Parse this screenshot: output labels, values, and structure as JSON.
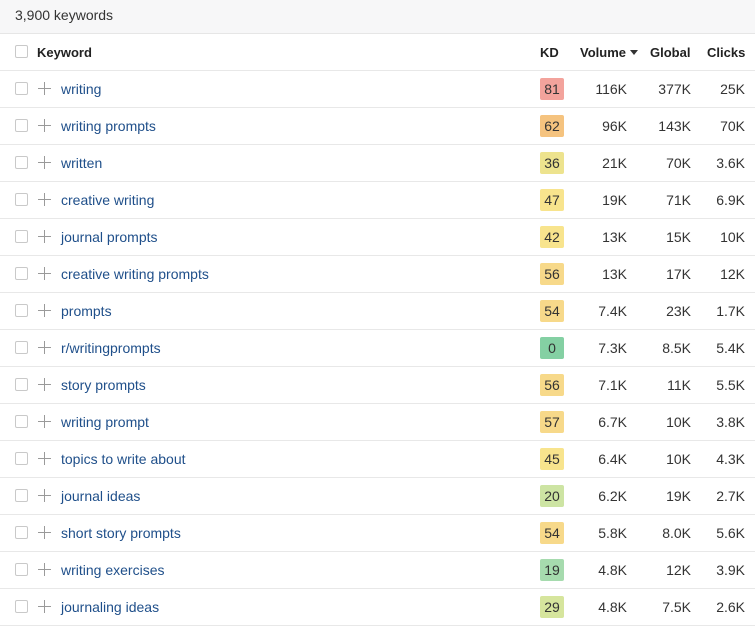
{
  "summary": {
    "count_label": "3,900 keywords"
  },
  "header": {
    "keyword": "Keyword",
    "kd": "KD",
    "volume": "Volume",
    "global": "Global",
    "clicks": "Clicks"
  },
  "kd_colors": {
    "red": "#f3a39c",
    "orange": "#f5c37f",
    "yellow": "#f8e48d",
    "light_green": "#d6e59d",
    "green": "#84d0a3"
  },
  "rows": [
    {
      "keyword": "writing",
      "kd": "81",
      "kd_color": "#f3a39c",
      "volume": "116K",
      "global": "377K",
      "clicks": "25K"
    },
    {
      "keyword": "writing prompts",
      "kd": "62",
      "kd_color": "#f5c37f",
      "volume": "96K",
      "global": "143K",
      "clicks": "70K"
    },
    {
      "keyword": "written",
      "kd": "36",
      "kd_color": "#ede38e",
      "volume": "21K",
      "global": "70K",
      "clicks": "3.6K"
    },
    {
      "keyword": "creative writing",
      "kd": "47",
      "kd_color": "#f8e48d",
      "volume": "19K",
      "global": "71K",
      "clicks": "6.9K"
    },
    {
      "keyword": "journal prompts",
      "kd": "42",
      "kd_color": "#f8e48d",
      "volume": "13K",
      "global": "15K",
      "clicks": "10K"
    },
    {
      "keyword": "creative writing prompts",
      "kd": "56",
      "kd_color": "#f7d98a",
      "volume": "13K",
      "global": "17K",
      "clicks": "12K"
    },
    {
      "keyword": "prompts",
      "kd": "54",
      "kd_color": "#f7d98a",
      "volume": "7.4K",
      "global": "23K",
      "clicks": "1.7K"
    },
    {
      "keyword": "r/writingprompts",
      "kd": "0",
      "kd_color": "#84d0a3",
      "volume": "7.3K",
      "global": "8.5K",
      "clicks": "5.4K"
    },
    {
      "keyword": "story prompts",
      "kd": "56",
      "kd_color": "#f7d98a",
      "volume": "7.1K",
      "global": "11K",
      "clicks": "5.5K"
    },
    {
      "keyword": "writing prompt",
      "kd": "57",
      "kd_color": "#f7d98a",
      "volume": "6.7K",
      "global": "10K",
      "clicks": "3.8K"
    },
    {
      "keyword": "topics to write about",
      "kd": "45",
      "kd_color": "#f8e48d",
      "volume": "6.4K",
      "global": "10K",
      "clicks": "4.3K"
    },
    {
      "keyword": "journal ideas",
      "kd": "20",
      "kd_color": "#cde4a3",
      "volume": "6.2K",
      "global": "19K",
      "clicks": "2.7K"
    },
    {
      "keyword": "short story prompts",
      "kd": "54",
      "kd_color": "#f7d98a",
      "volume": "5.8K",
      "global": "8.0K",
      "clicks": "5.6K"
    },
    {
      "keyword": "writing exercises",
      "kd": "19",
      "kd_color": "#a6dbae",
      "volume": "4.8K",
      "global": "12K",
      "clicks": "3.9K"
    },
    {
      "keyword": "journaling ideas",
      "kd": "29",
      "kd_color": "#d6e59d",
      "volume": "4.8K",
      "global": "7.5K",
      "clicks": "2.6K"
    }
  ]
}
